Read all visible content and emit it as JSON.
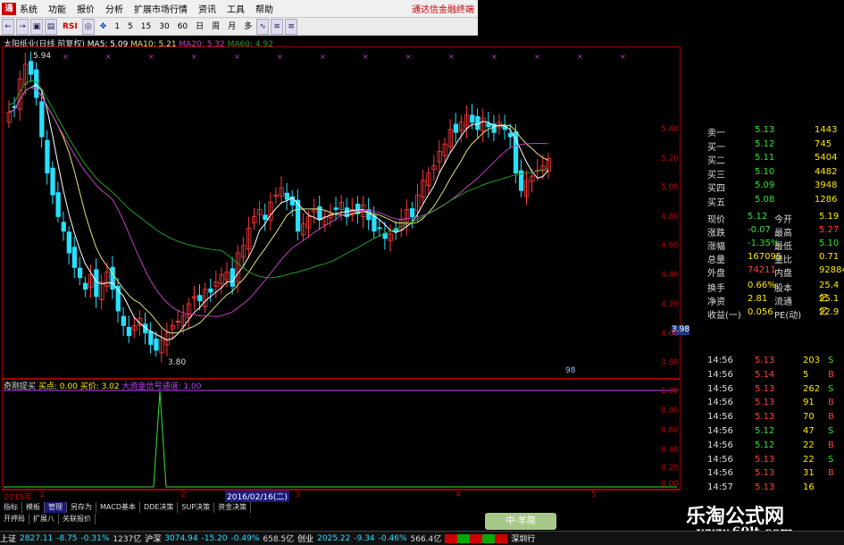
{
  "menu": {
    "items": [
      "系统",
      "功能",
      "报价",
      "分析",
      "扩展市场行情",
      "资讯",
      "工具",
      "帮助"
    ],
    "brand": "通达信金融终端"
  },
  "toolbar": {
    "items": [
      "←",
      "→",
      "▣",
      "▤",
      "RSI",
      "◎",
      "✥",
      "1",
      "5",
      "15",
      "30",
      "60",
      "日",
      "周",
      "月",
      "多",
      "∿",
      "≋",
      "≡"
    ]
  },
  "chart": {
    "ma_title": "太阳纸业(日线 前复权)",
    "ma5": "MA5: 5.09",
    "ma10": "MA10: 5.21",
    "ma20": "MA20: 5.32",
    "ma60": "MA60: 4.92",
    "high_label": "5.94",
    "low_label": "3.80",
    "count_label": "98",
    "y_ticks": [
      "5.40",
      "5.20",
      "5.00",
      "4.80",
      "4.60",
      "4.40",
      "4.20",
      "4.00",
      "3.80"
    ],
    "price_box": "3.98",
    "x_labels": [
      "2015年",
      "1",
      "2",
      "2016/02/16(二)",
      "3",
      "4",
      "5"
    ],
    "colors": {
      "up": "#ff3a3a",
      "down": "#27e0ff",
      "ma5": "#ffffff",
      "ma10": "#e3e37a",
      "ma20": "#c040c0",
      "ma60": "#22a022"
    }
  },
  "indicator": {
    "name": "奇刚提买",
    "buy_point": "买点: 0.00",
    "buy_price": "买价: 3.02",
    "signal": "大资金信号通道: 1.00",
    "y_ticks": [
      "1.00",
      "0.80",
      "0.60",
      "0.40",
      "0.20",
      "0.00"
    ]
  },
  "quote": {
    "book": [
      {
        "name": "卖一",
        "price": "5.13",
        "vol": "1443"
      },
      {
        "name": "买一",
        "price": "5.12",
        "vol": "745"
      },
      {
        "name": "买二",
        "price": "5.11",
        "vol": "5404"
      },
      {
        "name": "买三",
        "price": "5.10",
        "vol": "4482"
      },
      {
        "name": "买四",
        "price": "5.09",
        "vol": "3948"
      },
      {
        "name": "买五",
        "price": "5.08",
        "vol": "1286"
      }
    ],
    "stats": [
      {
        "l1": "现价",
        "v1": "5.12",
        "l2": "今开",
        "v2": "5.19"
      },
      {
        "l1": "涨跌",
        "v1": "-0.07",
        "l2": "最高",
        "v2": "5.27"
      },
      {
        "l1": "涨幅",
        "v1": "-1.35%",
        "l2": "最低",
        "v2": "5.10"
      },
      {
        "l1": "总量",
        "v1": "167095",
        "l2": "量比",
        "v2": "0.71"
      },
      {
        "l1": "外盘",
        "v1": "74211",
        "l2": "内盘",
        "v2": "92884"
      },
      {
        "l1": "换手",
        "v1": "0.66%",
        "l2": "股本",
        "v2": "25.4亿"
      },
      {
        "l1": "净资",
        "v1": "2.81",
        "l2": "流通",
        "v2": "25.1亿"
      },
      {
        "l1": "收益(一)",
        "v1": "0.056",
        "l2": "PE(动)",
        "v2": "22.9"
      }
    ],
    "ticks": [
      {
        "t": "14:56",
        "p": "5.13",
        "v": "203",
        "d": "S"
      },
      {
        "t": "14:56",
        "p": "5.14",
        "v": "5",
        "d": "B"
      },
      {
        "t": "14:56",
        "p": "5.13",
        "v": "262",
        "d": "S"
      },
      {
        "t": "14:56",
        "p": "5.13",
        "v": "91",
        "d": "B"
      },
      {
        "t": "14:56",
        "p": "5.13",
        "v": "70",
        "d": "B"
      },
      {
        "t": "14:56",
        "p": "5.12",
        "v": "47",
        "d": "S"
      },
      {
        "t": "14:56",
        "p": "5.12",
        "v": "22",
        "d": "B"
      },
      {
        "t": "14:56",
        "p": "5.13",
        "v": "22",
        "d": "S"
      },
      {
        "t": "14:56",
        "p": "5.13",
        "v": "31",
        "d": "B"
      },
      {
        "t": "14:57",
        "p": "5.13",
        "v": "16",
        "d": ""
      }
    ]
  },
  "tabs": {
    "row1": [
      "指标",
      "模板",
      "管理",
      "另存为",
      "MACD基本",
      "DDE决策",
      "SUP决策",
      "资金决策"
    ],
    "row2": [
      "开押局",
      "扩展八",
      "关联报价"
    ]
  },
  "status": {
    "sh_label": "上证",
    "sh_val": "2827.11",
    "sh_chg": "-8.75",
    "sh_pct": "-0.31%",
    "sh_amt": "1237亿",
    "hs_label": "沪深",
    "hs_val": "3074.94",
    "hs_chg": "-15.20",
    "hs_pct": "-0.49%",
    "hs_amt": "658.5亿",
    "cy_label": "创业",
    "cy_val": "2025.22",
    "cy_chg": "-9.34",
    "cy_pct": "-0.46%",
    "cy_amt": "566.4亿",
    "sz_label": "深圳行"
  },
  "badge": "中·羊简",
  "watermark": {
    "title": "乐淘公式网",
    "url": "www.60lt.com"
  }
}
